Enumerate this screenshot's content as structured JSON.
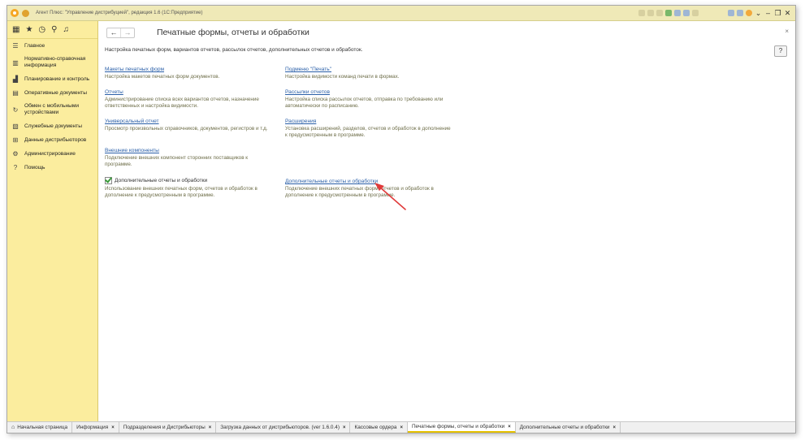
{
  "window": {
    "title": "Агент Плюс: \"Управление дистрибуцией\", редакция 1.6 (1С:Предприятие)"
  },
  "sidebar": {
    "tools": [
      {
        "name": "apps-grid-icon",
        "glyph": "▦"
      },
      {
        "name": "star-icon",
        "glyph": "★"
      },
      {
        "name": "history-icon",
        "glyph": "◷"
      },
      {
        "name": "search-icon",
        "glyph": "⚲"
      },
      {
        "name": "bell-icon",
        "glyph": "♫"
      }
    ],
    "items": [
      {
        "label": "Главное",
        "icon": "menu-lines-icon",
        "glyph": "☰"
      },
      {
        "label": "Нормативно-справочная информация",
        "icon": "books-icon",
        "glyph": "▥"
      },
      {
        "label": "Планирование и контроль",
        "icon": "chart-icon",
        "glyph": "▟"
      },
      {
        "label": "Оперативные документы",
        "icon": "document-icon",
        "glyph": "▤"
      },
      {
        "label": "Обмен с мобильными устройствами",
        "icon": "sync-icon",
        "glyph": "↻"
      },
      {
        "label": "Служебные документы",
        "icon": "service-doc-icon",
        "glyph": "▧"
      },
      {
        "label": "Данные дистрибьюторов",
        "icon": "distributor-icon",
        "glyph": "⊞"
      },
      {
        "label": "Администрирование",
        "icon": "gear-icon",
        "glyph": "⚙"
      },
      {
        "label": "Помощь",
        "icon": "help-icon",
        "glyph": "?"
      }
    ]
  },
  "content": {
    "back_glyph": "←",
    "forward_glyph": "→",
    "close_glyph": "×",
    "help_label": "?",
    "title": "Печатные формы, отчеты и обработки",
    "description": "Настройка печатных форм, вариантов отчетов, рассылок отчетов, дополнительных отчетов и обработок.",
    "left_sections": [
      {
        "link": "Макеты печатных форм",
        "text": "Настройка макетов печатных форм документов."
      },
      {
        "link": "Отчеты",
        "text": "Администрирование списка всех вариантов отчетов, назначение ответственных и настройка видимости."
      },
      {
        "link": "Универсальный отчет",
        "text": "Просмотр произвольных справочников, документов, регистров и т.д."
      },
      {
        "link": "Внешние компоненты",
        "text": "Подключение внешних компонент сторонних поставщиков к программе."
      }
    ],
    "right_sections": [
      {
        "link": "Подменю \"Печать\"",
        "text": "Настройка видимости команд печати в формах."
      },
      {
        "link": "Рассылки отчетов",
        "text": "Настройка списка рассылок отчетов, отправка по требованию или автоматически по расписанию."
      },
      {
        "link": "Расширения",
        "text": "Установка расширений, разделов, отчетов и обработок в дополнение к предусмотренным в программе."
      }
    ],
    "checkbox_section": {
      "label": "Дополнительные отчеты и обработки",
      "checked": true,
      "text": "Использование внешних печатных форм, отчетов и обработок в дополнение к предусмотренным в программе."
    },
    "extra_section": {
      "link": "Дополнительные отчеты и обработки",
      "text": "Подключение внешних печатных форм, отчетов и обработок в дополнение к предусмотренным в программе."
    }
  },
  "tabs": [
    {
      "label": "Начальная страница",
      "closable": false,
      "active": false
    },
    {
      "label": "Информация",
      "closable": true,
      "active": false
    },
    {
      "label": "Подразделения и Дистрибьюторы",
      "closable": true,
      "active": false
    },
    {
      "label": "Загрузка данных от дистрибьюторов. (ver 1.6.0.4)",
      "closable": true,
      "active": false
    },
    {
      "label": "Кассовые ордера",
      "closable": true,
      "active": false
    },
    {
      "label": "Печатные формы, отчеты и обработки",
      "closable": true,
      "active": true
    },
    {
      "label": "Дополнительные отчеты и обработки",
      "closable": true,
      "active": false
    }
  ],
  "colors": {
    "sidebar_bg": "#fbed9e",
    "titlebar_bg": "#efe9b7",
    "link": "#2a5fa8",
    "arrow": "#e03a3a"
  }
}
